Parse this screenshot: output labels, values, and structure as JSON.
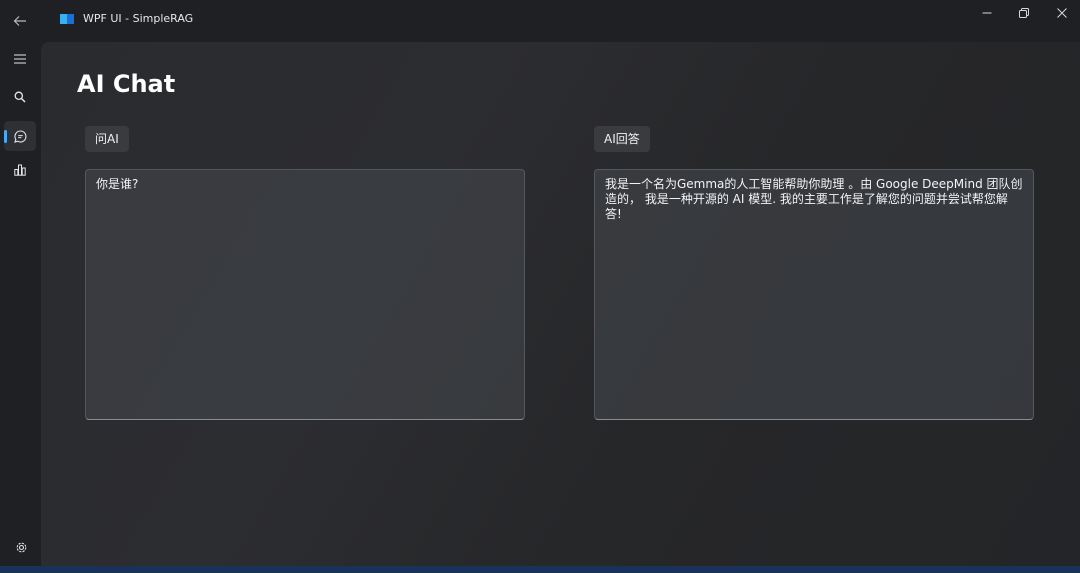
{
  "window": {
    "title": "WPF UI - SimpleRAG"
  },
  "nav": {
    "items": [
      {
        "icon": "hamburger-menu-icon"
      },
      {
        "icon": "search-icon"
      },
      {
        "icon": "chat-icon",
        "active": true
      },
      {
        "icon": "bar-chart-icon"
      }
    ],
    "settings_icon": "gear-icon"
  },
  "page": {
    "title": "AI Chat",
    "ask_label": "问AI",
    "answer_label": "AI回答",
    "question_text": "你是谁?",
    "answer_text": "我是一个名为Gemma的人工智能帮助你助理 。由 Google DeepMind 团队创造的， 我是一种开源的 AI 模型. 我的主要工作是了解您的问题并尝试帮您解答!"
  },
  "colors": {
    "accent": "#4aa8f5",
    "background": "#1f2023",
    "panel": "#2a2b2f"
  }
}
